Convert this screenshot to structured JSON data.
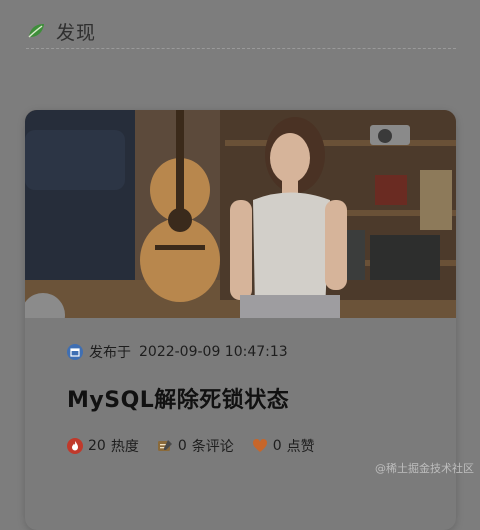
{
  "header": {
    "title": "发现",
    "icon": "leaf-icon"
  },
  "post": {
    "publish_label": "发布于",
    "publish_time": "2022-09-09 10:47:13",
    "title": "MySQL解除死锁状态",
    "stats": {
      "heat_count": "20",
      "heat_label": "热度",
      "comment_count": "0",
      "comment_label": "条评论",
      "like_count": "0",
      "like_label": "点赞"
    }
  },
  "watermark": "@稀土掘金技术社区",
  "colors": {
    "heat": "#c0392b",
    "like": "#c7662a",
    "publish_icon": "#3f6fb3"
  }
}
